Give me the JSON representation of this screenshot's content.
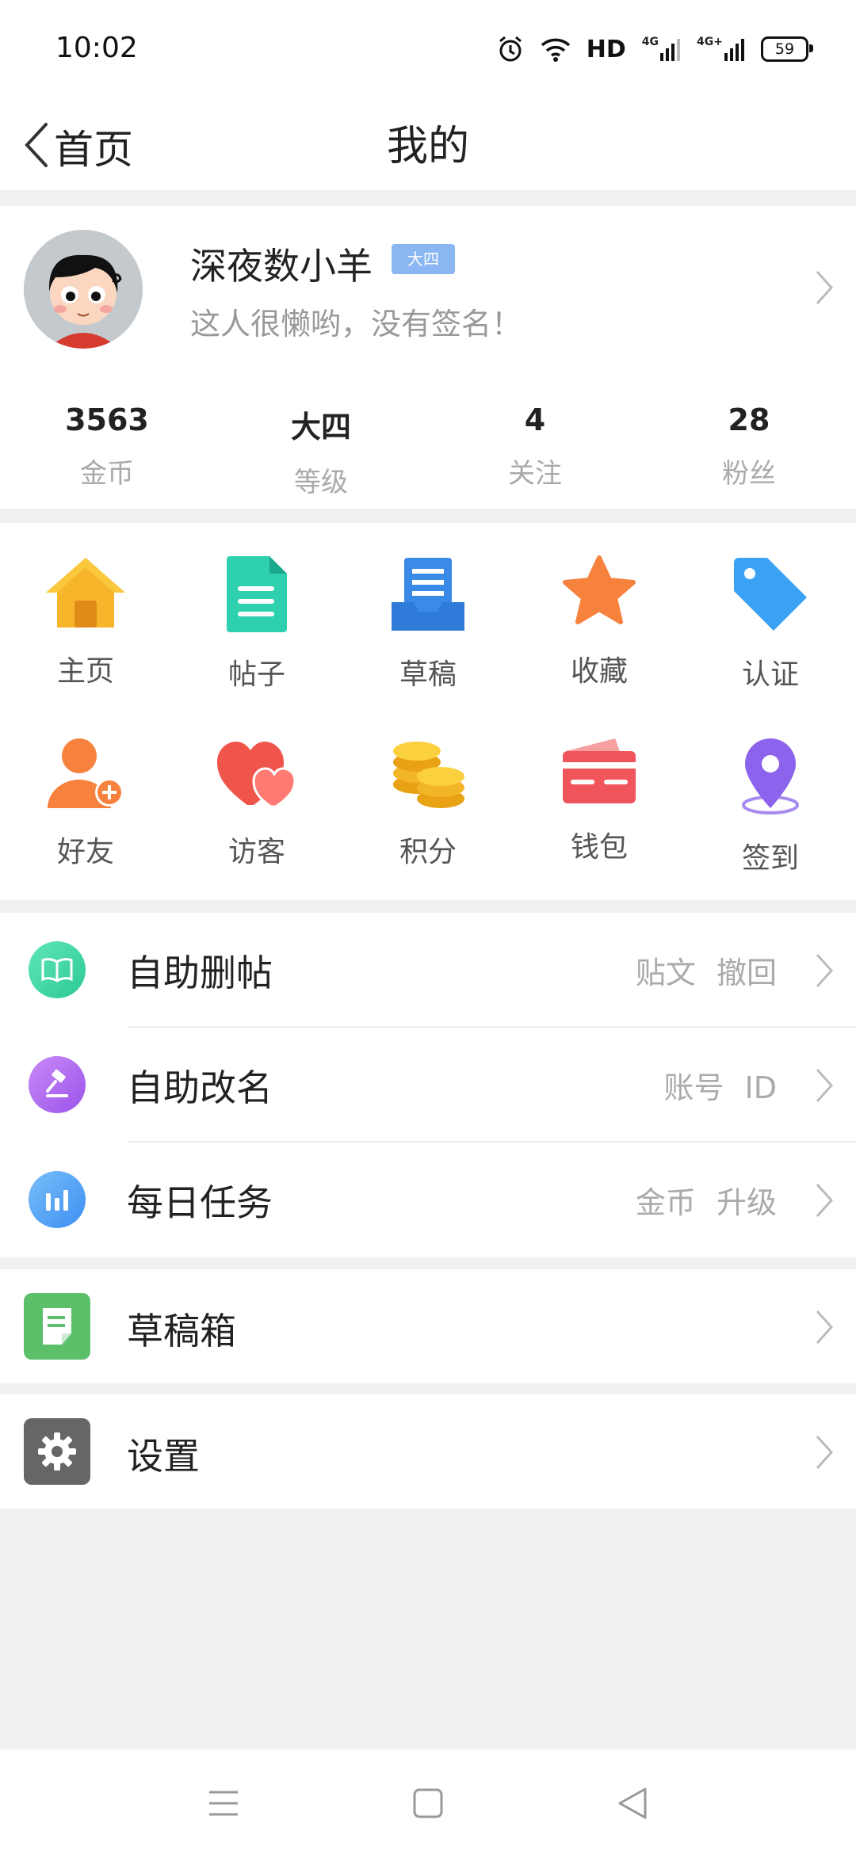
{
  "status_bar": {
    "time": "10:02",
    "icons": [
      "alarm-icon",
      "wifi-icon",
      "hd-icon",
      "signal-4g-icon",
      "signal-4g-plus-icon",
      "battery-icon"
    ],
    "hd_label": "HD",
    "net1": "4G",
    "net2": "4G+",
    "battery": "59"
  },
  "navbar": {
    "back_label": "首页",
    "title": "我的"
  },
  "profile": {
    "username": "深夜数小羊",
    "level_badge": "大四",
    "signature": "这人很懒哟，没有签名！",
    "stats": [
      {
        "value": "3563",
        "label": "金币"
      },
      {
        "value": "大四",
        "label": "等级"
      },
      {
        "value": "4",
        "label": "关注"
      },
      {
        "value": "28",
        "label": "粉丝"
      }
    ]
  },
  "grid": {
    "row1": [
      {
        "label": "主页",
        "icon": "home-icon"
      },
      {
        "label": "帖子",
        "icon": "document-icon"
      },
      {
        "label": "草稿",
        "icon": "draft-tray-icon"
      },
      {
        "label": "收藏",
        "icon": "star-icon"
      },
      {
        "label": "认证",
        "icon": "tag-icon"
      }
    ],
    "row2": [
      {
        "label": "好友",
        "icon": "add-friend-icon"
      },
      {
        "label": "访客",
        "icon": "hearts-icon"
      },
      {
        "label": "积分",
        "icon": "coins-icon"
      },
      {
        "label": "钱包",
        "icon": "wallet-icon"
      },
      {
        "label": "签到",
        "icon": "location-pin-icon"
      }
    ]
  },
  "list": [
    {
      "label": "自助删帖",
      "trail": "贴文 撤回",
      "icon": "book-icon",
      "color": "#3ed8a6"
    },
    {
      "label": "自助改名",
      "trail": "账号 ID",
      "icon": "gavel-icon",
      "color": "#b26af0"
    },
    {
      "label": "每日任务",
      "trail": "金币 升级",
      "icon": "bar-chart-icon",
      "color": "#5aa8f7"
    }
  ],
  "drafts": {
    "label": "草稿箱",
    "icon": "note-icon",
    "color": "#5cbf6a"
  },
  "settings": {
    "label": "设置",
    "icon": "gear-icon",
    "color": "#666666"
  },
  "colors": {
    "background": "#f1f1f1",
    "card": "#ffffff",
    "badge": "#8ab6f2",
    "muted_text": "#aaaaaa"
  }
}
